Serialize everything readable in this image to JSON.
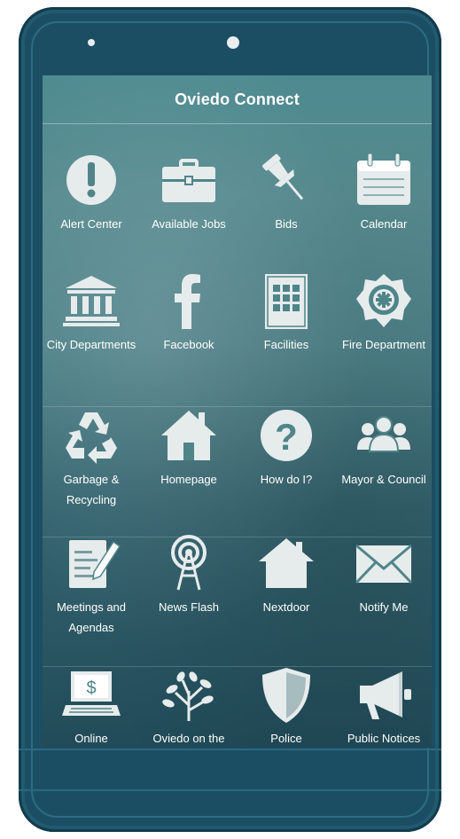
{
  "app": {
    "title": "Oviedo Connect"
  },
  "tiles": [
    {
      "label": "Alert Center",
      "icon": "exclamation-circle-icon"
    },
    {
      "label": "Available Jobs",
      "icon": "briefcase-icon"
    },
    {
      "label": "Bids",
      "icon": "pushpin-icon"
    },
    {
      "label": "Calendar",
      "icon": "calendar-icon"
    },
    {
      "label": "City Departments",
      "icon": "government-building-icon"
    },
    {
      "label": "Facebook",
      "icon": "facebook-icon"
    },
    {
      "label": "Facilities",
      "icon": "building-icon"
    },
    {
      "label": "Fire Department",
      "icon": "fire-emblem-icon"
    },
    {
      "label": "Garbage & Recycling",
      "icon": "recycle-icon"
    },
    {
      "label": "Homepage",
      "icon": "home-icon"
    },
    {
      "label": "How do I?",
      "icon": "question-circle-icon"
    },
    {
      "label": "Mayor & Council",
      "icon": "people-icon"
    },
    {
      "label": "Meetings and Agendas",
      "icon": "document-pencil-icon"
    },
    {
      "label": "News Flash",
      "icon": "radio-tower-icon"
    },
    {
      "label": "Nextdoor",
      "icon": "house-icon"
    },
    {
      "label": "Notify Me",
      "icon": "envelope-icon"
    },
    {
      "label": "Online",
      "icon": "laptop-dollar-icon"
    },
    {
      "label": "Oviedo on the",
      "icon": "tree-icon"
    },
    {
      "label": "Police",
      "icon": "shield-icon"
    },
    {
      "label": "Public Notices",
      "icon": "megaphone-icon"
    }
  ],
  "colors": {
    "phone_body": "#1c4e63",
    "icon": "#e6ebec",
    "text": "#ffffff"
  }
}
